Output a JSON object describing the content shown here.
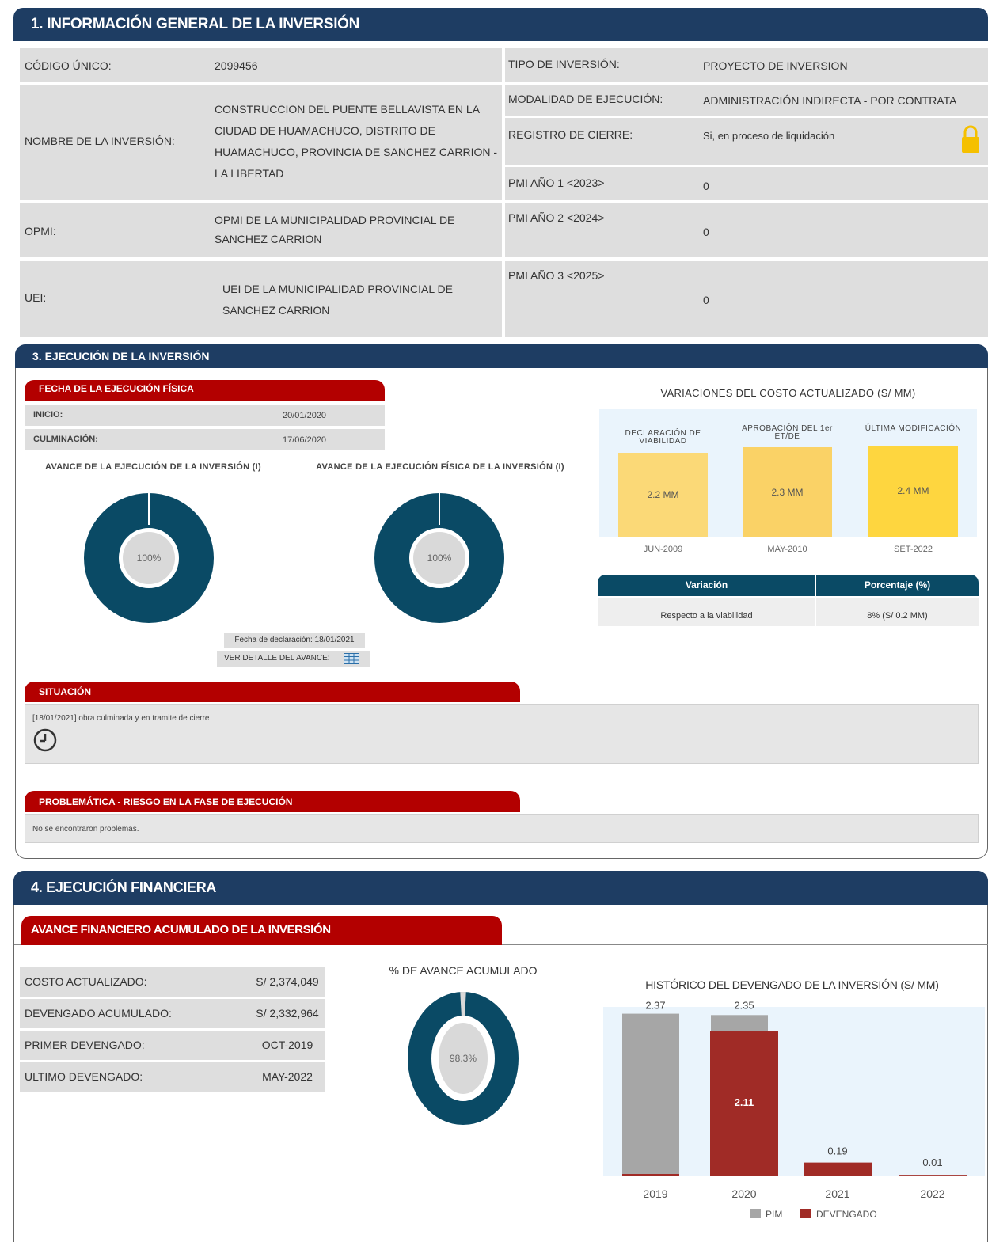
{
  "section1": {
    "title": "1. INFORMACIÓN GENERAL DE LA INVERSIÓN",
    "codigo_label": "CÓDIGO ÚNICO:",
    "codigo_value": "2099456",
    "nombre_label": "NOMBRE DE LA INVERSIÓN:",
    "nombre_value": "CONSTRUCCION DEL PUENTE BELLAVISTA EN LA CIUDAD DE HUAMACHUCO, DISTRITO DE HUAMACHUCO, PROVINCIA DE SANCHEZ CARRION - LA LIBERTAD",
    "opmi_label": "OPMI:",
    "opmi_value": "OPMI DE LA MUNICIPALIDAD PROVINCIAL DE SANCHEZ CARRION",
    "uei_label": "UEI:",
    "uei_value": "UEI DE LA MUNICIPALIDAD PROVINCIAL DE SANCHEZ CARRION",
    "tipo_label": "TIPO DE INVERSIÓN:",
    "tipo_value": "PROYECTO DE INVERSION",
    "modalidad_label": "MODALIDAD DE EJECUCIÓN:",
    "modalidad_value": "ADMINISTRACIÓN INDIRECTA - POR CONTRATA",
    "cierre_label": "REGISTRO DE CIERRE:",
    "cierre_value": "Si, en proceso de liquidación",
    "pmi1_label": "PMI AÑO 1 <2023>",
    "pmi1_value": "0",
    "pmi2_label": "PMI AÑO 2 <2024>",
    "pmi2_value": "0",
    "pmi3_label": "PMI AÑO 3 <2025>",
    "pmi3_value": "0"
  },
  "section3": {
    "title": "3. EJECUCIÓN DE LA INVERSIÓN",
    "fecha_tab": "FECHA DE LA EJECUCIÓN FÍSICA",
    "inicio_label": "INICIO:",
    "inicio_value": "20/01/2020",
    "culminacion_label": "CULMINACIÓN:",
    "culminacion_value": "17/06/2020",
    "avance_inv_title": "AVANCE DE LA EJECUCIÓN DE LA INVERSIÓN (I)",
    "avance_inv_value": "100%",
    "avance_inv_percent": 100,
    "avance_fis_title": "AVANCE DE LA EJECUCIÓN FÍSICA DE LA INVERSIÓN (I)",
    "avance_fis_value": "100%",
    "avance_fis_percent": 100,
    "fecha_declaracion": "Fecha de declaración: 18/01/2021",
    "ver_detalle": "VER DETALLE DEL AVANCE:",
    "variaciones_title": "VARIACIONES DEL COSTO ACTUALIZADO (S/ MM)",
    "costos": [
      {
        "label": "DECLARACIÓN DE VIABILIDAD",
        "value": "2.2 MM",
        "date": "JUN-2009",
        "color": "#fbd977"
      },
      {
        "label": "APROBACIÓN DEL 1er ET/DE",
        "value": "2.3 MM",
        "date": "MAY-2010",
        "color": "#fad266"
      },
      {
        "label": "ÚLTIMA MODIFICACIÓN",
        "value": "2.4 MM",
        "date": "SET-2022",
        "color": "#fed63f"
      }
    ],
    "var_table": {
      "col1": "Variación",
      "col2": "Porcentaje (%)",
      "row_label": "Respecto a la viabilidad",
      "row_value": "8% (S/ 0.2 MM)"
    },
    "situacion_tab": "SITUACIÓN",
    "situacion_text": "[18/01/2021] obra culminada y en tramite de cierre",
    "problematica_tab": "PROBLEMÁTICA - RIESGO EN LA FASE DE EJECUCIÓN",
    "problematica_text": "No se encontraron problemas."
  },
  "section4": {
    "title": "4. EJECUCIÓN FINANCIERA",
    "tab": "AVANCE FINANCIERO ACUMULADO DE LA INVERSIÓN",
    "rows": [
      {
        "label": "COSTO ACTUALIZADO:",
        "value": "S/ 2,374,049"
      },
      {
        "label": "DEVENGADO ACUMULADO:",
        "value": "S/ 2,332,964"
      },
      {
        "label": "PRIMER DEVENGADO:",
        "value": "OCT-2019"
      },
      {
        "label": "ULTIMO DEVENGADO:",
        "value": "MAY-2022"
      }
    ],
    "avance_title": "% DE AVANCE ACUMULADO",
    "avance_value": "98.3%",
    "avance_percent": 98.3,
    "chart_title": "HISTÓRICO DEL DEVENGADO DE LA INVERSIÓN (S/ MM)"
  },
  "colors": {
    "header": "#1e3d63",
    "tab_red": "#b30000",
    "donut": "#0a4a65",
    "pim": "#a6a6a6",
    "devengado": "#a02b26"
  },
  "chart_data": {
    "type": "bar",
    "title": "HISTÓRICO DEL DEVENGADO DE LA INVERSIÓN (S/ MM)",
    "categories": [
      "2019",
      "2020",
      "2021",
      "2022"
    ],
    "series": [
      {
        "name": "PIM",
        "values": [
          2.37,
          2.35,
          0,
          0
        ]
      },
      {
        "name": "DEVENGADO",
        "values": [
          0,
          2.11,
          0.19,
          0.01
        ]
      }
    ],
    "labels": [
      {
        "category": "2019",
        "text": "2.37"
      },
      {
        "category": "2020",
        "text": "2.35"
      },
      {
        "category": "2020",
        "text": "2.11"
      },
      {
        "category": "2021",
        "text": "0.19"
      },
      {
        "category": "2022",
        "text": "0.01"
      }
    ],
    "ylim": [
      0,
      2.4
    ],
    "legend": "bottom"
  }
}
